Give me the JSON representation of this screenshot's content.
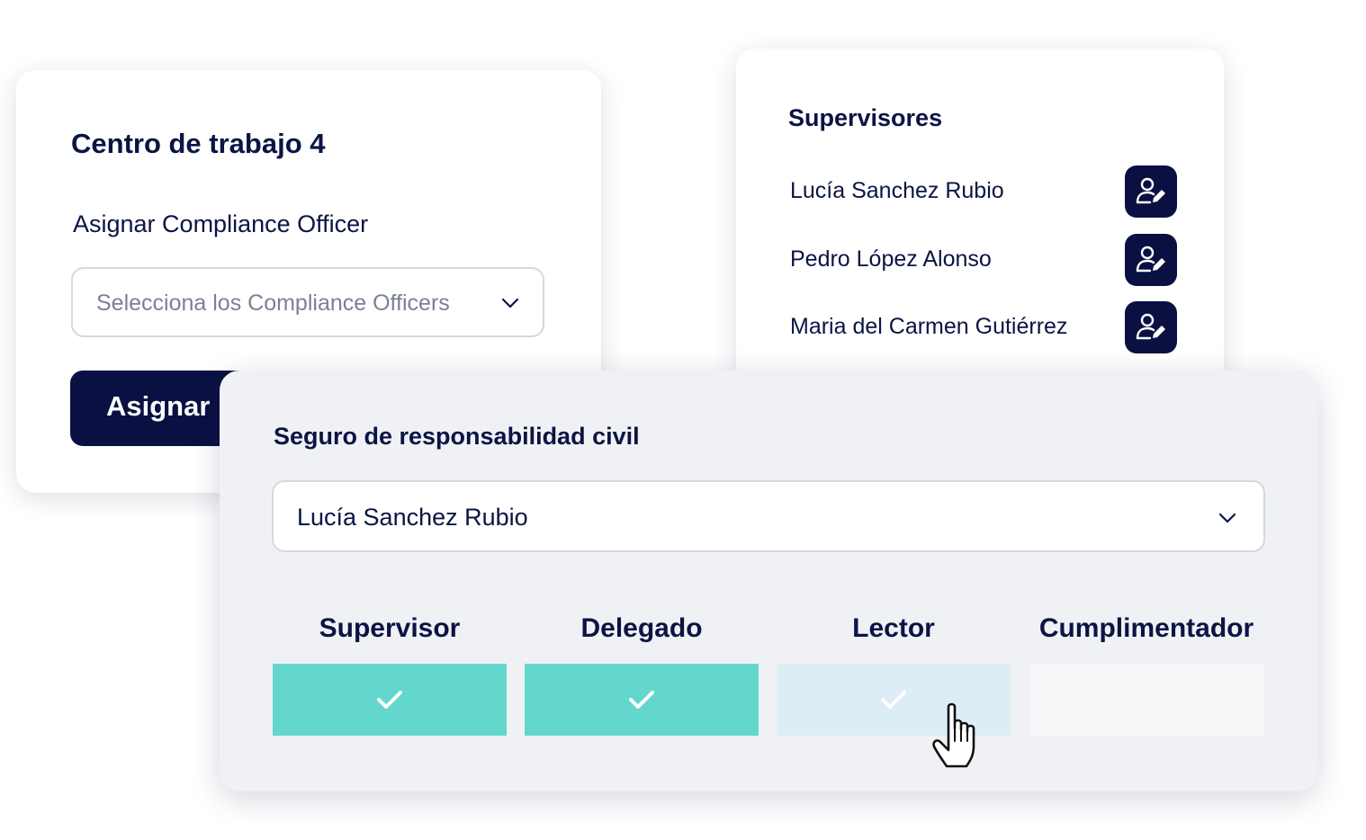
{
  "centro": {
    "title": "Centro de trabajo 4",
    "label": "Asignar Compliance Officer",
    "select_placeholder": "Selecciona los Compliance Officers",
    "button_label": "Asignar"
  },
  "supervisores": {
    "title": "Supervisores",
    "items": [
      {
        "name": "Lucía Sanchez Rubio"
      },
      {
        "name": "Pedro López Alonso"
      },
      {
        "name": "Maria del Carmen Gutiérrez"
      }
    ]
  },
  "seguro": {
    "title": "Seguro de responsabilidad civil",
    "selected_user": "Lucía Sanchez Rubio",
    "roles": [
      {
        "label": "Supervisor",
        "state": "checked"
      },
      {
        "label": "Delegado",
        "state": "checked"
      },
      {
        "label": "Lector",
        "state": "hover"
      },
      {
        "label": "Cumplimentador",
        "state": "unchecked"
      }
    ]
  },
  "colors": {
    "navy": "#0a1142",
    "teal": "#64d7cc",
    "hover": "#dcedf6"
  }
}
